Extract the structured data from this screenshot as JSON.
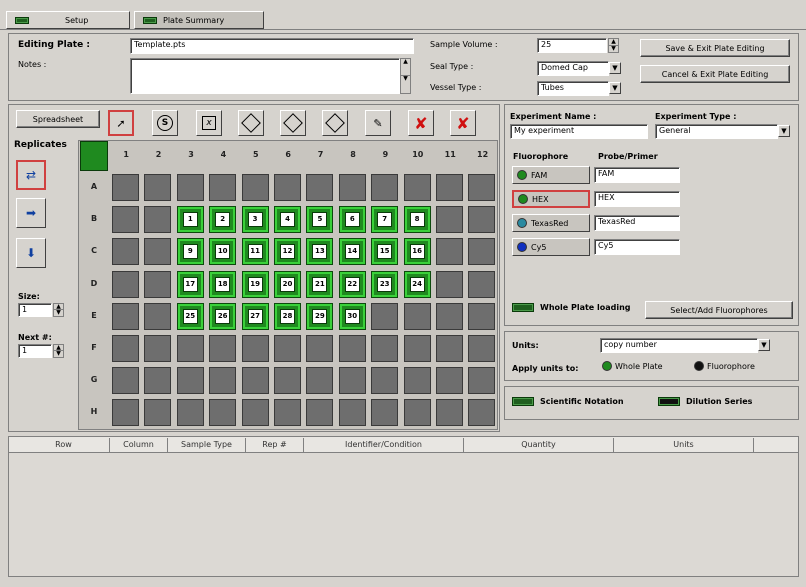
{
  "tabs": [
    {
      "label": "Setup"
    },
    {
      "label": "Plate Summary"
    }
  ],
  "editing": {
    "title": "Editing Plate :",
    "notes_label": "Notes :",
    "plate_name": "Template.pts",
    "notes_value": ""
  },
  "sample": {
    "volume_label": "Sample Volume :",
    "volume_value": "25",
    "seal_label": "Seal Type :",
    "seal_value": "Domed Cap",
    "vessel_label": "Vessel Type :",
    "vessel_value": "Tubes"
  },
  "buttons": {
    "save_exit": "Save & Exit Plate Editing",
    "cancel_exit": "Cancel & Exit Plate Editing",
    "spreadsheet": "Spreadsheet",
    "select_add": "Select/Add Fluorophores"
  },
  "replicates": {
    "label": "Replicates",
    "size_label": "Size:",
    "size_value": "1",
    "next_label": "Next #:",
    "next_value": "1"
  },
  "plate": {
    "columns": [
      "1",
      "2",
      "3",
      "4",
      "5",
      "6",
      "7",
      "8",
      "9",
      "10",
      "11",
      "12"
    ],
    "rows": [
      "A",
      "B",
      "C",
      "D",
      "E",
      "F",
      "G",
      "H"
    ],
    "wells": [
      {
        "row": 1,
        "col": 2,
        "n": "1"
      },
      {
        "row": 1,
        "col": 3,
        "n": "2"
      },
      {
        "row": 1,
        "col": 4,
        "n": "3"
      },
      {
        "row": 1,
        "col": 5,
        "n": "4"
      },
      {
        "row": 1,
        "col": 6,
        "n": "5"
      },
      {
        "row": 1,
        "col": 7,
        "n": "6"
      },
      {
        "row": 1,
        "col": 8,
        "n": "7"
      },
      {
        "row": 1,
        "col": 9,
        "n": "8"
      },
      {
        "row": 2,
        "col": 2,
        "n": "9"
      },
      {
        "row": 2,
        "col": 3,
        "n": "10"
      },
      {
        "row": 2,
        "col": 4,
        "n": "11"
      },
      {
        "row": 2,
        "col": 5,
        "n": "12"
      },
      {
        "row": 2,
        "col": 6,
        "n": "13"
      },
      {
        "row": 2,
        "col": 7,
        "n": "14"
      },
      {
        "row": 2,
        "col": 8,
        "n": "15"
      },
      {
        "row": 2,
        "col": 9,
        "n": "16"
      },
      {
        "row": 3,
        "col": 2,
        "n": "17"
      },
      {
        "row": 3,
        "col": 3,
        "n": "18"
      },
      {
        "row": 3,
        "col": 4,
        "n": "19"
      },
      {
        "row": 3,
        "col": 5,
        "n": "20"
      },
      {
        "row": 3,
        "col": 6,
        "n": "21"
      },
      {
        "row": 3,
        "col": 7,
        "n": "22"
      },
      {
        "row": 3,
        "col": 8,
        "n": "23"
      },
      {
        "row": 3,
        "col": 9,
        "n": "24"
      },
      {
        "row": 4,
        "col": 2,
        "n": "25"
      },
      {
        "row": 4,
        "col": 3,
        "n": "26"
      },
      {
        "row": 4,
        "col": 4,
        "n": "27"
      },
      {
        "row": 4,
        "col": 5,
        "n": "28"
      },
      {
        "row": 4,
        "col": 6,
        "n": "29"
      },
      {
        "row": 4,
        "col": 7,
        "n": "30"
      }
    ]
  },
  "experiment": {
    "name_label": "Experiment Name :",
    "name_value": "My experiment",
    "type_label": "Experiment Type :",
    "type_value": "General"
  },
  "fluorophores": {
    "header_fluor": "Fluorophore",
    "header_probe": "Probe/Primer",
    "items": [
      {
        "name": "FAM",
        "probe": "FAM",
        "color": "#1f8a1f"
      },
      {
        "name": "HEX",
        "probe": "HEX",
        "color": "#1f8a1f"
      },
      {
        "name": "TexasRed",
        "probe": "TexasRed",
        "color": "#2a8aa0"
      },
      {
        "name": "Cy5",
        "probe": "Cy5",
        "color": "#1030c0"
      }
    ],
    "whole_plate": "Whole Plate loading"
  },
  "units": {
    "label": "Units:",
    "value": "copy number",
    "apply_label": "Apply units to:",
    "opt_whole": "Whole Plate",
    "opt_fluor": "Fluorophore"
  },
  "bottom_opts": {
    "sci": "Scientific Notation",
    "dilution": "Dilution Series"
  },
  "table": {
    "headers": [
      "Row",
      "Column",
      "Sample Type",
      "Rep #",
      "Identifier/Condition",
      "Quantity",
      "Units"
    ]
  }
}
